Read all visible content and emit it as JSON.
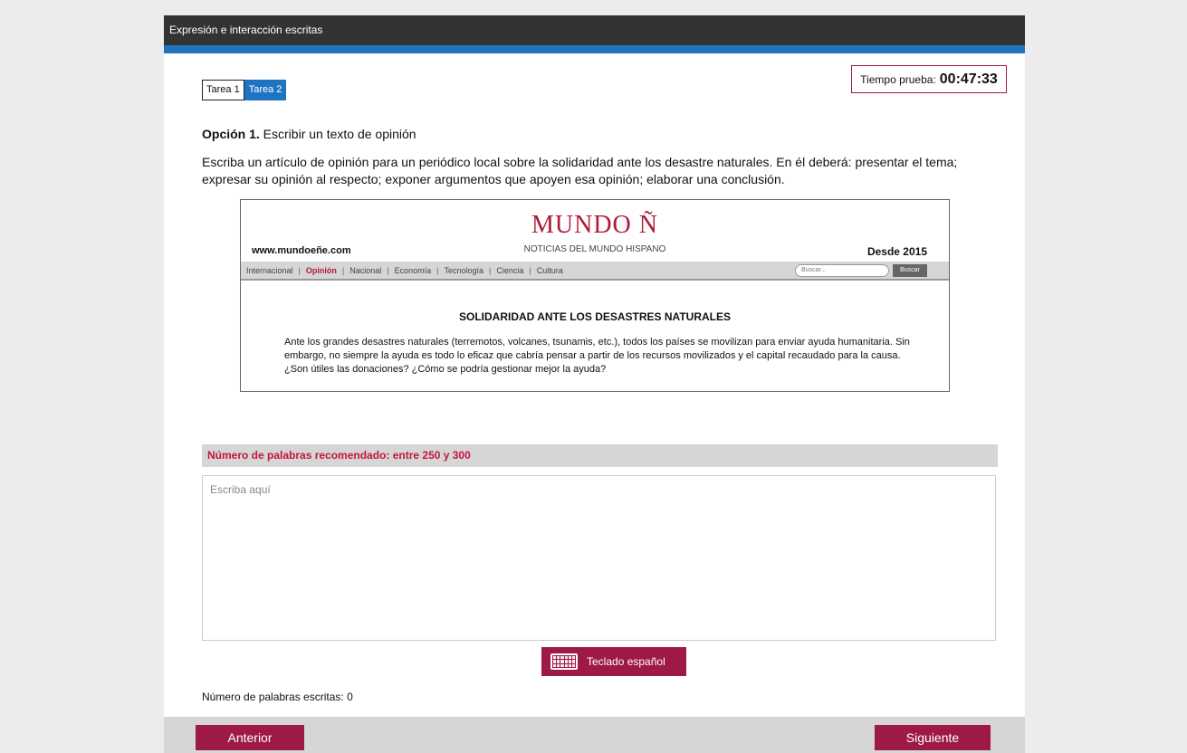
{
  "window": {
    "title": "Expresión e interacción escritas"
  },
  "tabs": [
    {
      "label": "Tarea 1",
      "active": false
    },
    {
      "label": "Tarea 2",
      "active": true
    }
  ],
  "timer": {
    "label": "Tiempo prueba:",
    "value": "00:47:33"
  },
  "task": {
    "option_bold": "Opción 1.",
    "option_text": " Escribir un texto de opinión",
    "instructions": "Escriba un artículo de opinión para un periódico local sobre la solidaridad ante los desastre naturales. En él deberá: presentar el tema; expresar su opinión al respecto; exponer argumentos que apoyen esa opinión; elaborar una conclusión."
  },
  "newspaper": {
    "logo": "MUNDO Ñ",
    "subtitle": "NOTICIAS DEL MUNDO HISPANO",
    "url": "www.mundoeñe.com",
    "since": "Desde 2015",
    "nav": [
      "Internacional",
      "Opinión",
      "Nacional",
      "Economía",
      "Tecnología",
      "Ciencia",
      "Cultura"
    ],
    "search_placeholder": "Buscar...",
    "search_button": "Buscar",
    "headline": "SOLIDARIDAD ANTE LOS DESASTRES NATURALES",
    "body": "Ante los grandes desastres naturales (terremotos, volcanes, tsunamis, etc.), todos los países se movilizan para enviar ayuda humanitaria. Sin embargo, no siempre la ayuda es todo lo eficaz que cabría pensar a partir de los recursos movilizados y el capital recaudado para la causa. ¿Son útiles las donaciones? ¿Cómo se podría gestionar mejor la ayuda?"
  },
  "words": {
    "recommended": "Número de palabras recomendado: entre 250 y 300",
    "placeholder": "Escriba aquí",
    "written": "Número de palabras escritas: 0"
  },
  "keyboard_button": "Teclado español",
  "footer": {
    "prev": "Anterior",
    "next": "Siguiente"
  },
  "colors": {
    "accent": "#9e1848",
    "blue": "#1f74c1",
    "red_text": "#c4163f"
  }
}
